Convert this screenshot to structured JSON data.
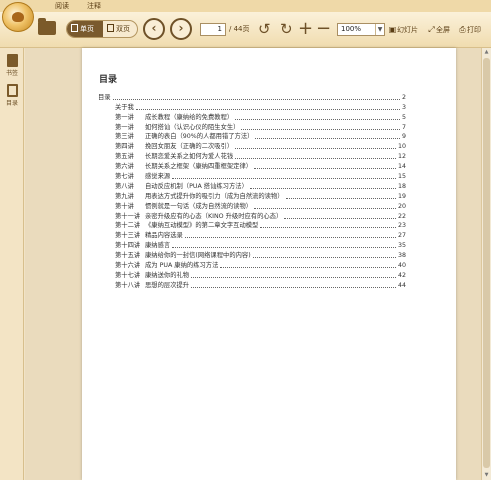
{
  "menu": {
    "tabs": [
      "阅读",
      "注释"
    ]
  },
  "toolbar": {
    "single_page": "单页",
    "double_page": "双页",
    "current_page": "1",
    "total_pages": "/ 44页",
    "zoom": "100%",
    "slideshow": "幻灯片",
    "fullscreen": "全屏",
    "print": "打印",
    "icons": {
      "prev": "arrow-left-icon",
      "next": "arrow-right-icon",
      "rotate_left": "rotate-left-icon",
      "rotate_right": "rotate-right-icon",
      "zoom_in": "plus-icon",
      "zoom_out": "minus-icon"
    }
  },
  "sidebar": {
    "bookmark": "书签",
    "toc": "目录"
  },
  "doc": {
    "title": "目录",
    "entries": [
      {
        "num": "",
        "text": "目录",
        "page": "2",
        "level": 0
      },
      {
        "num": "",
        "text": "关于我",
        "page": "3",
        "level": 1
      },
      {
        "num": "第一讲",
        "text": "成长教程（康纳给的免费教程）",
        "page": "5",
        "level": 1
      },
      {
        "num": "第一讲",
        "text": "如何搭讪（认识心仪的陌生女生）",
        "page": "7",
        "level": 1
      },
      {
        "num": "第三讲",
        "text": "正确的表白（90%的人都用错了方法）",
        "page": "9",
        "level": 1
      },
      {
        "num": "第四讲",
        "text": "挽回女朋友（正确的二次吸引）",
        "page": "10",
        "level": 1
      },
      {
        "num": "第五讲",
        "text": "长期恋爱关系之如何为爱人花钱",
        "page": "12",
        "level": 1
      },
      {
        "num": "第六讲",
        "text": "长期关系之框架（康纳四重框架定律）",
        "page": "14",
        "level": 1
      },
      {
        "num": "第七讲",
        "text": "感觉来源",
        "page": "15",
        "level": 1
      },
      {
        "num": "第八讲",
        "text": "自动反应机制（PUA 搭讪练习方法）",
        "page": "18",
        "level": 1
      },
      {
        "num": "第九讲",
        "text": "用表达方式提升你的吸引力（成为自然流的读物）",
        "page": "19",
        "level": 1
      },
      {
        "num": "第十讲",
        "text": "惯例就是一句话（成为自然流的读物）",
        "page": "20",
        "level": 1
      },
      {
        "num": "第十一讲",
        "text": "亲密升级应有的心态（KINO 升级时应有的心态）",
        "page": "22",
        "level": 1
      },
      {
        "num": "第十二讲",
        "text": "《康纳互动模型》的第二章文字互动模型",
        "page": "23",
        "level": 1
      },
      {
        "num": "第十三讲",
        "text": "精品内容选录",
        "page": "27",
        "level": 1
      },
      {
        "num": "第十四讲",
        "text": "康纳感言",
        "page": "35",
        "level": 1
      },
      {
        "num": "第十五讲",
        "text": "康纳给你的一封信(网络课程中的内容)",
        "page": "38",
        "level": 1
      },
      {
        "num": "第十六讲",
        "text": "成为 PUA 康纳的练习方法",
        "page": "40",
        "level": 1
      },
      {
        "num": "第十七讲",
        "text": "康纳送你的礼物",
        "page": "42",
        "level": 1
      },
      {
        "num": "第十八讲",
        "text": "思想的层次提升",
        "page": "44",
        "level": 1
      }
    ]
  },
  "colors": {
    "toolbar_bg": "#f0dcaf",
    "frame_bg": "#f1e3c6",
    "accent": "#7a5a2e"
  }
}
